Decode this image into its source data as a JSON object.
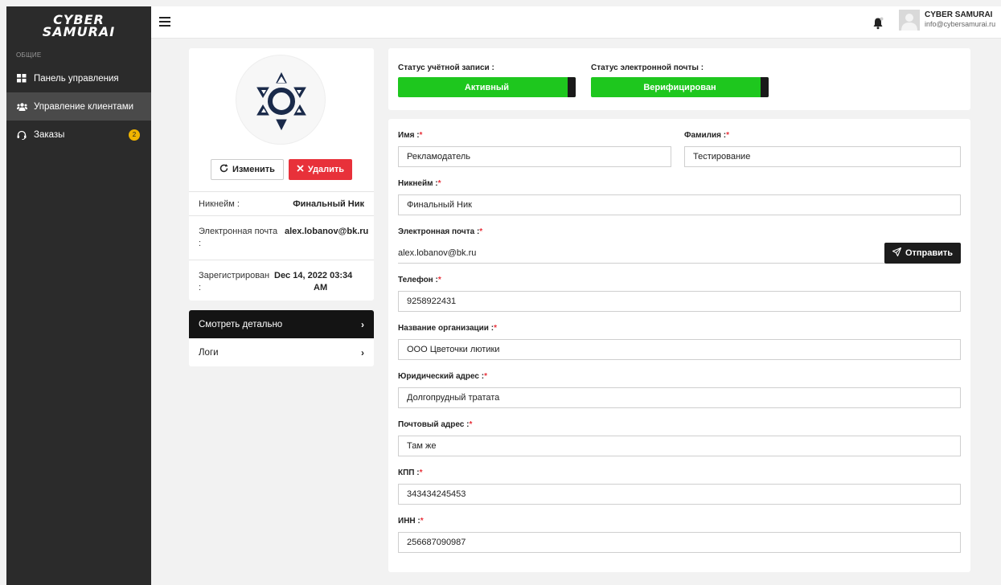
{
  "sidebar": {
    "logo_line1": "CYBER",
    "logo_line2": "SAMURAI",
    "section_label": "ОБЩИЕ",
    "items": [
      {
        "label": "Панель управления",
        "icon": "grid-icon"
      },
      {
        "label": "Управление клиентами",
        "icon": "users-icon"
      },
      {
        "label": "Заказы",
        "icon": "headset-icon",
        "badge": "2"
      }
    ]
  },
  "topbar": {
    "user_name": "CYBER SAMURAI",
    "user_email": "info@cybersamurai.ru"
  },
  "profile": {
    "edit_label": "Изменить",
    "delete_label": "Удалить",
    "nickname_label": "Никнейм :",
    "nickname_value": "Финальный Ник",
    "email_label": "Электронная почта",
    "email_colon": ":",
    "email_value": "alex.lobanov@bk.ru",
    "registered_label": "Зарегистрирован",
    "registered_colon": ":",
    "registered_value_line1": "Dec 14, 2022 03:34",
    "registered_value_line2": "AM"
  },
  "nav": {
    "details_label": "Смотреть детально",
    "logs_label": "Логи"
  },
  "status": {
    "account_label": "Статус учётной записи :",
    "account_value": "Активный",
    "email_label": "Статус электронной почты :",
    "email_value": "Верифицирован",
    "color": "#1ec71e"
  },
  "form": {
    "first_name": {
      "label": "Имя :",
      "value": "Рекламодатель"
    },
    "last_name": {
      "label": "Фамилия :",
      "value": "Тестирование"
    },
    "nickname": {
      "label": "Никнейм :",
      "value": "Финальный Ник"
    },
    "email": {
      "label": "Электронная почта :",
      "value": "alex.lobanov@bk.ru"
    },
    "send_label": "Отправить",
    "phone": {
      "label": "Телефон :",
      "value": "9258922431"
    },
    "org_name": {
      "label": "Название организации :",
      "value": "ООО Цветочки лютики"
    },
    "legal_address": {
      "label": "Юридический адрес :",
      "value": "Долгопрудный тратата"
    },
    "postal_address": {
      "label": "Почтовый адрес :",
      "value": "Там же"
    },
    "kpp": {
      "label": "КПП :",
      "value": "343434245453"
    },
    "inn": {
      "label": "ИНН :",
      "value": "256687090987"
    },
    "required_mark": "*"
  },
  "colors": {
    "accent_red": "#e8313a",
    "sidebar_bg": "#2b2b2b",
    "badge_yellow": "#f0b400"
  }
}
